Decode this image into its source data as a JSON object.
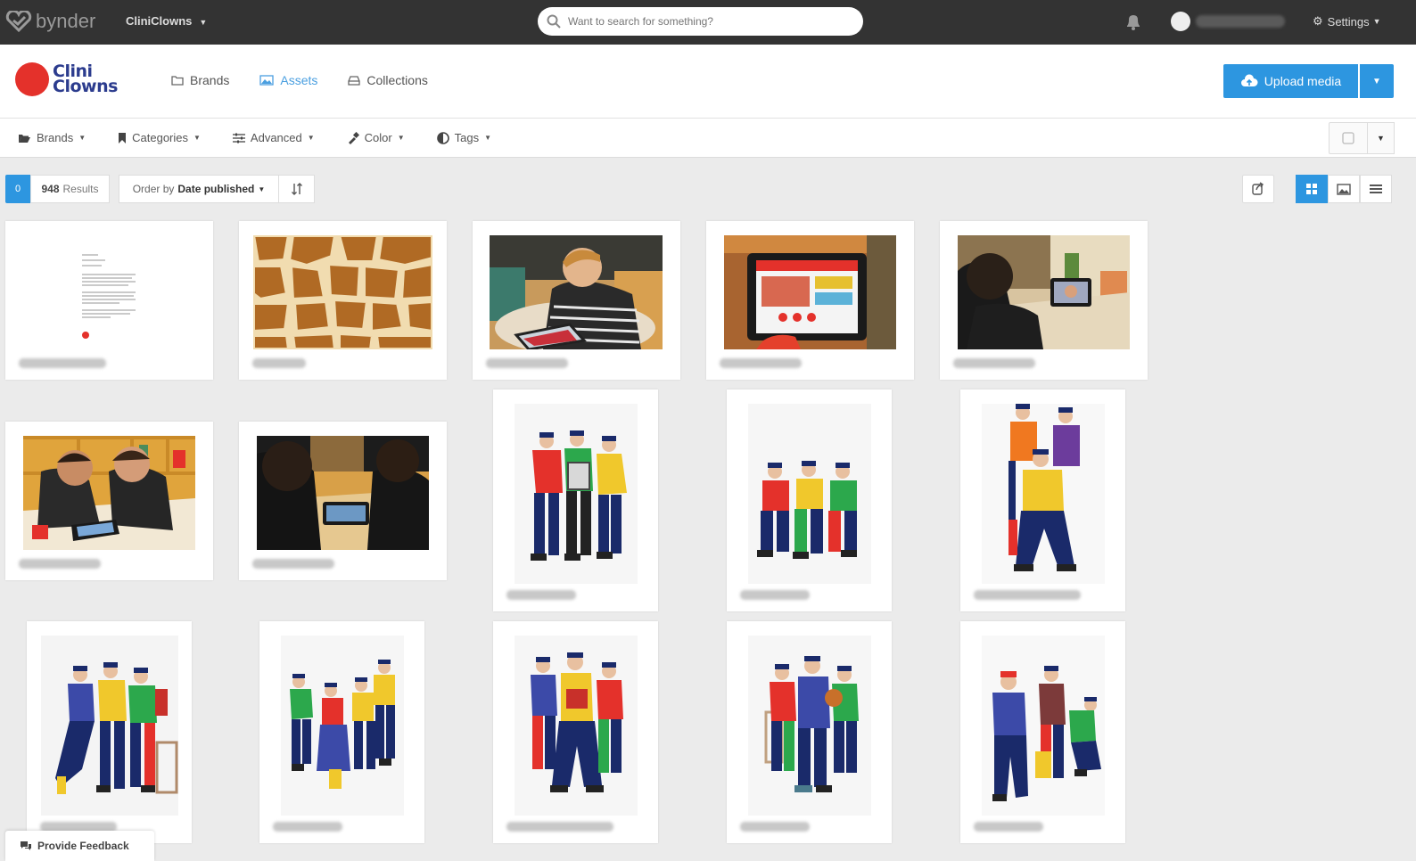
{
  "topbar": {
    "logo_text": "bynder",
    "brand_switch": "CliniClowns",
    "search_placeholder": "Want to search for something?",
    "settings_label": "Settings"
  },
  "header": {
    "logo_line1": "Clini",
    "logo_line2": "Clowns",
    "nav": [
      {
        "label": "Brands",
        "icon": "folder-icon",
        "active": false
      },
      {
        "label": "Assets",
        "icon": "image-icon",
        "active": true
      },
      {
        "label": "Collections",
        "icon": "collections-icon",
        "active": false
      }
    ],
    "upload_label": "Upload media"
  },
  "filters": [
    {
      "label": "Brands",
      "icon": "folder-open-icon"
    },
    {
      "label": "Categories",
      "icon": "bookmark-icon"
    },
    {
      "label": "Advanced",
      "icon": "sliders-icon"
    },
    {
      "label": "Color",
      "icon": "eyedropper-icon"
    },
    {
      "label": "Tags",
      "icon": "tag-icon"
    }
  ],
  "results": {
    "selected_count": "0",
    "count": "948",
    "count_label": "Results",
    "order_prefix": "Order by",
    "order_value": "Date published"
  },
  "assets": [
    {
      "kind": "document"
    },
    {
      "kind": "giraffe"
    },
    {
      "kind": "boy-tablet"
    },
    {
      "kind": "tablet-app"
    },
    {
      "kind": "child-table"
    },
    {
      "kind": "two-boys"
    },
    {
      "kind": "boys-tablet"
    },
    {
      "kind": "clowns-3"
    },
    {
      "kind": "clowns-seated"
    },
    {
      "kind": "clowns-stack"
    },
    {
      "kind": "clowns-dance"
    },
    {
      "kind": "clowns-jump"
    },
    {
      "kind": "clowns-group"
    },
    {
      "kind": "clowns-group2"
    },
    {
      "kind": "clowns-walk"
    }
  ],
  "feedback_label": "Provide Feedback",
  "colors": {
    "accent": "#2d96e0",
    "topbar": "#333333",
    "brand_red": "#e4312b",
    "brand_blue": "#2c3c8e"
  }
}
